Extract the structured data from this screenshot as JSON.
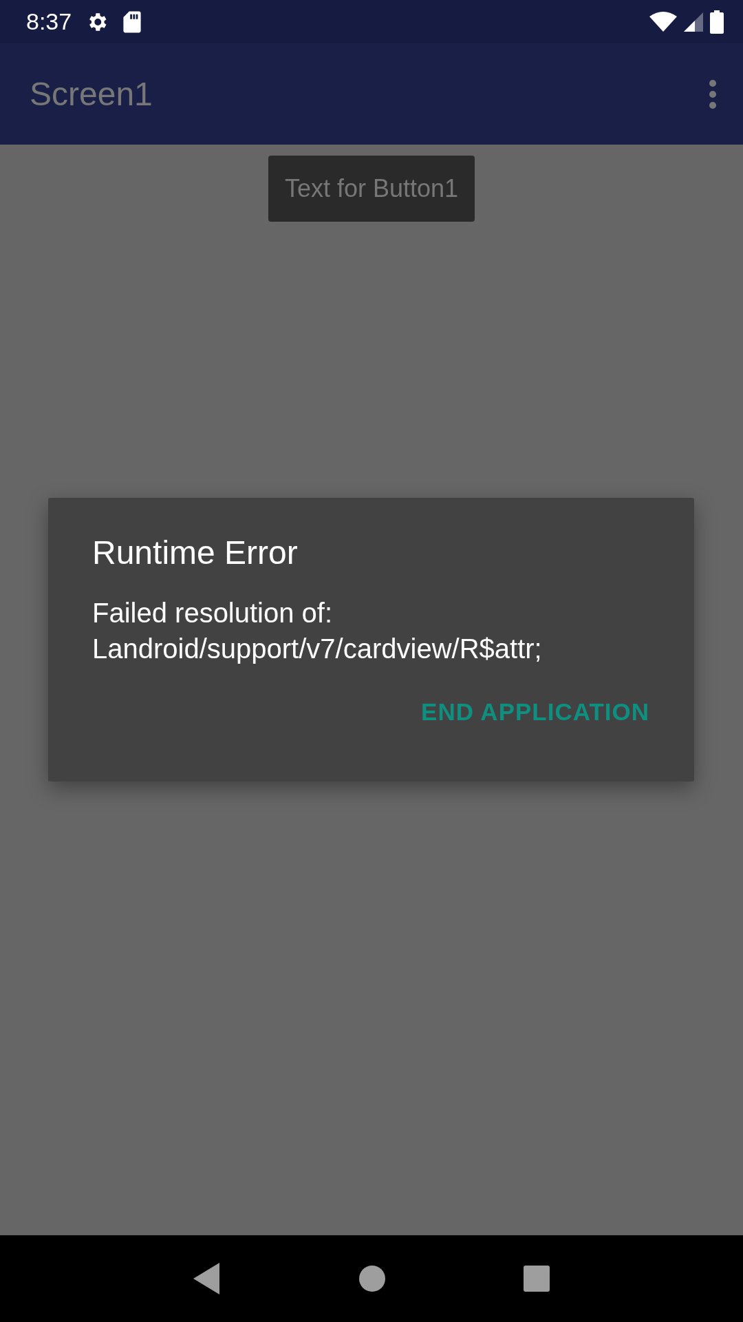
{
  "status_bar": {
    "time": "8:37"
  },
  "app_bar": {
    "title": "Screen1"
  },
  "content": {
    "button": "Text for Button1"
  },
  "dialog": {
    "title": "Runtime Error",
    "message": "Failed resolution of: Landroid/support/v7/cardview/R$attr;",
    "buttons": [
      "END APPLICATION"
    ]
  }
}
